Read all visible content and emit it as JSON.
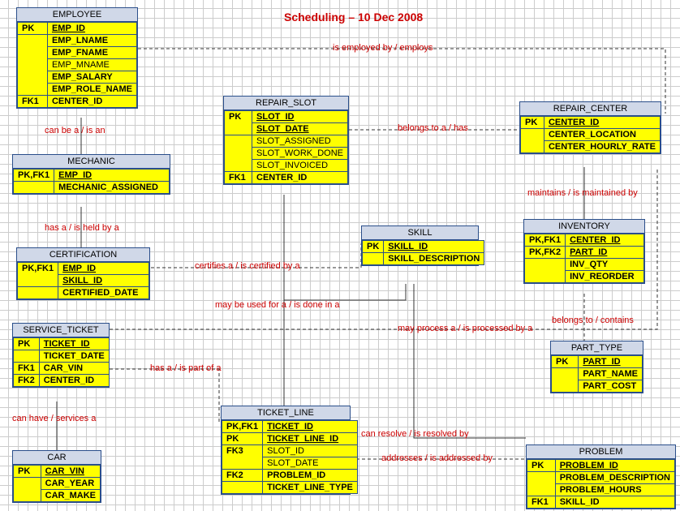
{
  "title": "Scheduling – 10 Dec 2008",
  "entities": {
    "employee": {
      "name": "EMPLOYEE",
      "rows": [
        {
          "tag": "PK",
          "attr": "EMP_ID",
          "u": true,
          "b": true
        },
        {
          "sep": true
        },
        {
          "tag": "",
          "attr": "EMP_LNAME",
          "b": true
        },
        {
          "tag": "",
          "attr": "EMP_FNAME",
          "b": true
        },
        {
          "tag": "",
          "attr": "EMP_MNAME"
        },
        {
          "tag": "",
          "attr": "EMP_SALARY",
          "b": true
        },
        {
          "tag": "",
          "attr": "EMP_ROLE_NAME",
          "b": true
        },
        {
          "tag": "FK1",
          "attr": "CENTER_ID",
          "b": true
        }
      ]
    },
    "mechanic": {
      "name": "MECHANIC",
      "rows": [
        {
          "tag": "PK,FK1",
          "attr": "EMP_ID",
          "u": true,
          "b": true
        },
        {
          "sep": true
        },
        {
          "tag": "",
          "attr": "MECHANIC_ASSIGNED",
          "b": true
        }
      ]
    },
    "certification": {
      "name": "CERTIFICATION",
      "rows": [
        {
          "tag": "PK,FK1",
          "attr": "EMP_ID",
          "u": true,
          "b": true
        },
        {
          "tag": "PK,FK1",
          "attr": "SKILL_ID",
          "u": true,
          "b": true
        },
        {
          "sep": true
        },
        {
          "tag": "",
          "attr": "CERTIFIED_DATE",
          "b": true
        }
      ]
    },
    "service_ticket": {
      "name": "SERVICE_TICKET",
      "rows": [
        {
          "tag": "PK",
          "attr": "TICKET_ID",
          "u": true,
          "b": true
        },
        {
          "sep": true
        },
        {
          "tag": "",
          "attr": "TICKET_DATE",
          "b": true
        },
        {
          "tag": "FK1",
          "attr": "CAR_VIN",
          "b": true
        },
        {
          "tag": "FK2",
          "attr": "CENTER_ID",
          "b": true
        }
      ]
    },
    "car": {
      "name": "CAR",
      "rows": [
        {
          "tag": "PK",
          "attr": "CAR_VIN",
          "u": true,
          "b": true
        },
        {
          "sep": true
        },
        {
          "tag": "",
          "attr": "CAR_YEAR",
          "b": true
        },
        {
          "tag": "",
          "attr": "CAR_MAKE",
          "b": true
        }
      ]
    },
    "repair_slot": {
      "name": "REPAIR_SLOT",
      "rows": [
        {
          "tag": "PK",
          "attr": "SLOT_ID",
          "u": true,
          "b": true
        },
        {
          "tag": "PK",
          "attr": "SLOT_DATE",
          "u": true,
          "b": true
        },
        {
          "sep": true
        },
        {
          "tag": "",
          "attr": "SLOT_ASSIGNED"
        },
        {
          "tag": "",
          "attr": "SLOT_WORK_DONE"
        },
        {
          "tag": "",
          "attr": "SLOT_INVOICED"
        },
        {
          "tag": "FK1",
          "attr": "CENTER_ID",
          "b": true
        }
      ]
    },
    "skill": {
      "name": "SKILL",
      "rows": [
        {
          "tag": "PK",
          "attr": "SKILL_ID",
          "u": true,
          "b": true
        },
        {
          "sep": true
        },
        {
          "tag": "",
          "attr": "SKILL_DESCRIPTION",
          "b": true
        }
      ]
    },
    "ticket_line": {
      "name": "TICKET_LINE",
      "rows": [
        {
          "tag": "PK,FK1",
          "attr": "TICKET_ID",
          "u": true,
          "b": true
        },
        {
          "tag": "PK",
          "attr": "TICKET_LINE_ID",
          "u": true,
          "b": true
        },
        {
          "sep": true
        },
        {
          "tag": "FK3",
          "attr": "SLOT_ID"
        },
        {
          "tag": "FK3",
          "attr": "SLOT_DATE"
        },
        {
          "tag": "FK2",
          "attr": "PROBLEM_ID",
          "b": true
        },
        {
          "tag": "",
          "attr": "TICKET_LINE_TYPE",
          "b": true
        }
      ]
    },
    "repair_center": {
      "name": "REPAIR_CENTER",
      "rows": [
        {
          "tag": "PK",
          "attr": "CENTER_ID",
          "u": true,
          "b": true
        },
        {
          "sep": true
        },
        {
          "tag": "",
          "attr": "CENTER_LOCATION",
          "b": true
        },
        {
          "tag": "",
          "attr": "CENTER_HOURLY_RATE",
          "b": true
        }
      ]
    },
    "inventory": {
      "name": "INVENTORY",
      "rows": [
        {
          "tag": "PK,FK1",
          "attr": "CENTER_ID",
          "u": true,
          "b": true
        },
        {
          "tag": "PK,FK2",
          "attr": "PART_ID",
          "u": true,
          "b": true
        },
        {
          "sep": true
        },
        {
          "tag": "",
          "attr": "INV_QTY",
          "b": true
        },
        {
          "tag": "",
          "attr": "INV_REORDER",
          "b": true
        }
      ]
    },
    "part_type": {
      "name": "PART_TYPE",
      "rows": [
        {
          "tag": "PK",
          "attr": "PART_ID",
          "u": true,
          "b": true
        },
        {
          "sep": true
        },
        {
          "tag": "",
          "attr": "PART_NAME",
          "b": true
        },
        {
          "tag": "",
          "attr": "PART_COST",
          "b": true
        }
      ]
    },
    "problem": {
      "name": "PROBLEM",
      "rows": [
        {
          "tag": "PK",
          "attr": "PROBLEM_ID",
          "u": true,
          "b": true
        },
        {
          "sep": true
        },
        {
          "tag": "",
          "attr": "PROBLEM_DESCRIPTION",
          "b": true
        },
        {
          "tag": "",
          "attr": "PROBLEM_HOURS",
          "b": true
        },
        {
          "tag": "FK1",
          "attr": "SKILL_ID",
          "b": true
        }
      ]
    }
  },
  "relations": {
    "emp_center": "is employed by / employs",
    "emp_mechanic": "can be a / is an",
    "mech_cert": "has a / is held by a",
    "cert_skill": "certifies a / is certified by a",
    "slot_skill": "may be used for a / is done in a",
    "ticket_line1": "has a / is part of a",
    "slot_center": "belongs to a / has",
    "center_inv": "maintains / is maintained by",
    "ticket_center": "may process a / is processed by a",
    "inv_part": "belongs to / contains",
    "ticket_car": "can have  / services a",
    "line_problem": "addresses / is addressed by",
    "skill_problem": "can resolve / is resolved by"
  }
}
